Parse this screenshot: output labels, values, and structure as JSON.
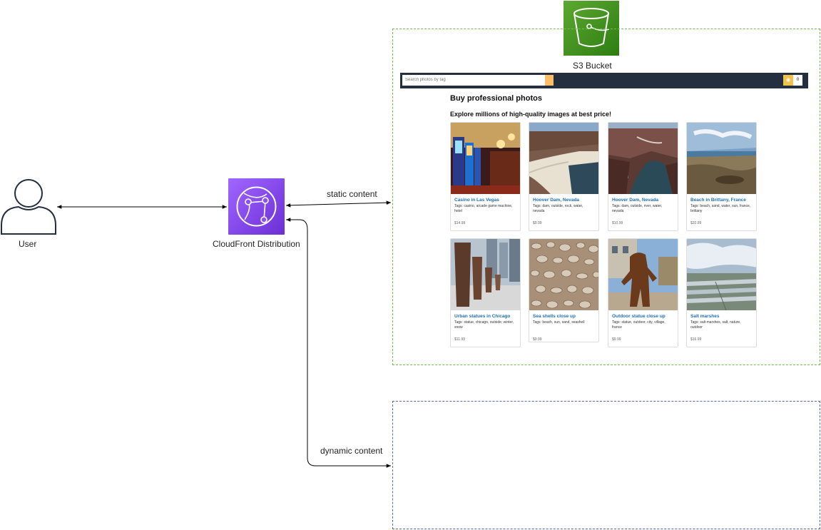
{
  "diagram": {
    "user_label": "User",
    "cloudfront_label": "CloudFront Distribution",
    "s3_label": "S3 Bucket",
    "static_edge_label": "static content",
    "dynamic_edge_label": "dynamic content",
    "colors": {
      "cloudfront": "#8c4fff",
      "s3": "#3f8624",
      "s3_box_border": "#6fbf4a",
      "dynamic_box_border": "#5a6ab8"
    }
  },
  "site": {
    "search_placeholder": "Search photos by tag",
    "cart_count": "0",
    "title": "Buy professional photos",
    "subtitle": "Explore millions of high-quality images at best price!",
    "colors": {
      "header": "#232f3e",
      "accent": "#febd69",
      "link": "#1f6fb2"
    },
    "products": [
      {
        "title": "Casino in Las Vegas",
        "tags": "Tags: casino, arcade game machine, hotel",
        "price": "$14.99",
        "image": "casino-photo"
      },
      {
        "title": "Hoover Dam, Nevada",
        "tags": "Tags: dam, outside, rock, water, nevada",
        "price": "$9.99",
        "image": "dam-photo"
      },
      {
        "title": "Hoover Dam, Nevada",
        "tags": "Tags: dam, outside, river, water, nevada",
        "price": "$10.99",
        "image": "dam-river-photo"
      },
      {
        "title": "Beach in Brittany, France",
        "tags": "Tags: beach, sand, water, sun, france, brittany",
        "price": "$20.99",
        "image": "beach-photo"
      },
      {
        "title": "Urban statues in Chicago",
        "tags": "Tags: statue, chicago, outside, winter, snow",
        "price": "$11.99",
        "image": "statues-photo"
      },
      {
        "title": "Sea shells close up",
        "tags": "Tags: beach, sun, sand, seashell",
        "price": "$9.99",
        "image": "shells-photo"
      },
      {
        "title": "Outdoor statue close up",
        "tags": "Tags: statue, outdoor, city, village, france",
        "price": "$9.99",
        "image": "outdoor-statue-photo"
      },
      {
        "title": "Salt marshes",
        "tags": "Tags: salt marshes, salt, nature, outdoor",
        "price": "$16.99",
        "image": "salt-marsh-photo"
      }
    ]
  }
}
